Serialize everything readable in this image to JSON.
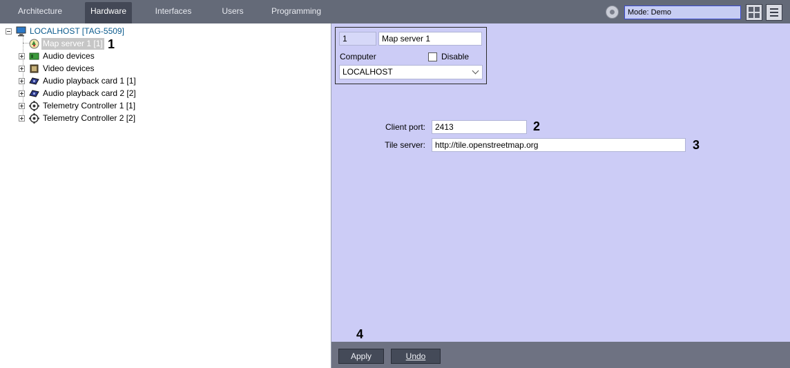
{
  "topbar": {
    "tabs": [
      {
        "label": "Architecture",
        "active": false
      },
      {
        "label": "Hardware",
        "active": true
      },
      {
        "label": "Interfaces",
        "active": false
      },
      {
        "label": "Users",
        "active": false
      },
      {
        "label": "Programming",
        "active": false
      }
    ],
    "mode_text": "Mode: Demo",
    "icons": {
      "mode": "settings-icon",
      "grid": "grid-layout-icon",
      "menu": "menu-icon"
    }
  },
  "tree": {
    "root": {
      "label": "LOCALHOST [TAG-5509]",
      "icon": "computer-icon"
    },
    "items": [
      {
        "label": "Map server 1 [1]",
        "icon": "map-server-icon",
        "selected": true,
        "expandable": false
      },
      {
        "label": "Audio devices",
        "icon": "audio-devices-icon",
        "selected": false,
        "expandable": true
      },
      {
        "label": "Video devices",
        "icon": "video-devices-icon",
        "selected": false,
        "expandable": true
      },
      {
        "label": "Audio playback card 1 [1]",
        "icon": "audio-card-icon",
        "selected": false,
        "expandable": true
      },
      {
        "label": "Audio playback card 2 [2]",
        "icon": "audio-card-icon",
        "selected": false,
        "expandable": true
      },
      {
        "label": "Telemetry Controller 1 [1]",
        "icon": "telemetry-icon",
        "selected": false,
        "expandable": true
      },
      {
        "label": "Telemetry Controller 2 [2]",
        "icon": "telemetry-icon",
        "selected": false,
        "expandable": true
      }
    ]
  },
  "settings": {
    "id_value": "1",
    "name_value": "Map server 1",
    "computer_label": "Computer",
    "disable_label": "Disable",
    "disable_checked": false,
    "computer_value": "LOCALHOST",
    "client_port_label": "Client port:",
    "client_port_value": "2413",
    "tile_server_label": "Tile server:",
    "tile_server_value": "http://tile.openstreetmap.org"
  },
  "callouts": {
    "one": "1",
    "two": "2",
    "three": "3",
    "four": "4"
  },
  "bottombar": {
    "apply_label": "Apply",
    "undo_label": "Undo"
  },
  "colors": {
    "topbar": "#646a78",
    "active_tab": "#434856",
    "settings_bg": "#ccccf6",
    "mode_box": "#c7cdf3",
    "bottombar": "#6e7282"
  }
}
